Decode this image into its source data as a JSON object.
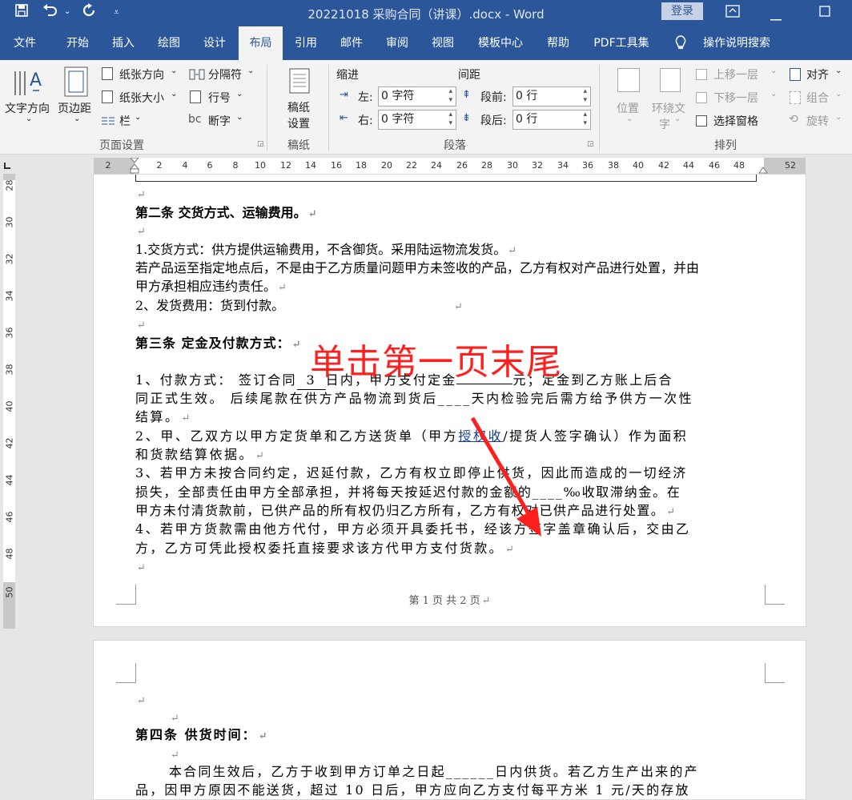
{
  "titlebar": {
    "title": "20221018 采购合同（讲课）.docx  -  Word",
    "login": "登录"
  },
  "tabs": [
    "文件",
    "开始",
    "插入",
    "绘图",
    "设计",
    "布局",
    "引用",
    "邮件",
    "审阅",
    "视图",
    "模板中心",
    "帮助",
    "PDF工具集",
    "操作说明搜索"
  ],
  "ribbon": {
    "text_direction": "文字方向",
    "margins": "页边距",
    "orientation": "纸张方向",
    "size": "纸张大小",
    "columns": "栏",
    "breaks": "分隔符",
    "line_numbers": "行号",
    "hyphenation": "断字",
    "page_setup": "页面设置",
    "manuscript_btn1": "稿纸",
    "manuscript_btn2": "设置",
    "manuscript": "稿纸",
    "indent": "缩进",
    "spacing": "间距",
    "left": "左:",
    "right": "右:",
    "before": "段前:",
    "after": "段后:",
    "left_val": "0 字符",
    "right_val": "0 字符",
    "before_val": "0 行",
    "after_val": "0 行",
    "paragraph": "段落",
    "position": "位置",
    "wrap1": "环绕文",
    "wrap2": "字",
    "bring_forward": "上移一层",
    "send_backward": "下移一层",
    "selection_pane": "选择窗格",
    "align": "对齐",
    "group": "组合",
    "rotate": "旋转",
    "arrange": "排列"
  },
  "ruler": {
    "h": [
      "2",
      "2",
      "4",
      "6",
      "8",
      "10",
      "12",
      "14",
      "16",
      "18",
      "20",
      "22",
      "24",
      "26",
      "28",
      "30",
      "32",
      "34",
      "36",
      "38",
      "40",
      "42",
      "44",
      "46",
      "48",
      "52"
    ],
    "v": [
      "28",
      "30",
      "32",
      "34",
      "36",
      "38",
      "40",
      "42",
      "44",
      "46",
      "48",
      "50"
    ]
  },
  "page1": {
    "l1": "第二条  交货方式、运输费用。",
    "l2": "1.交货方式：供方提供运输费用，不含御货。采用陆运物流发货。",
    "l3": "若产品运至指定地点后，不是由于乙方质量问题甲方未签收的产品，乙方有权对产品进行处置，并由",
    "l4": "甲方承担相应违约责任。",
    "l5": "2、发货费用：货到付款。",
    "l6": "第三条   定金及付款方式：",
    "l7a": "1、付款方式：   签订合同",
    "l7b": "3",
    "l7c": "日内，甲方支付定金",
    "l7d": "元；定金到乙方账上后合",
    "l8": "同正式生效。  后续尾款在供方产品物流到货后____天内检验完后需方给予供方一次性",
    "l9": "结算。",
    "l10a": "2、甲、乙双方以甲方定货单和乙方送货单（甲方",
    "l10b": "授权收",
    "l10c": "/提货人签字确认）作为面积",
    "l11": "和货款结算依据。",
    "l12": "3、若甲方未按合同约定，迟延付款，乙方有权立即停止供货，因此而造成的一切经济",
    "l13": "损失，全部责任由甲方全部承担，并将每天按延迟付款的金额的____‰收取滞纳金。在",
    "l14": "甲方未付清货款前，已供产品的所有权仍归乙方所有，乙方有权对已供产品进行处置。",
    "l15": "4、若甲方货款需由他方代付，甲方必须开具委托书，经该方签字盖章确认后，交由乙",
    "l16": "方，乙方可凭此授权委托直接要求该方代甲方支付货款。",
    "footer": "第 1 页 共 2 页"
  },
  "page2": {
    "l1": "第四条    供货时间：",
    "l2": "本合同生效后，乙方于收到甲方订单之日起______日内供货。若乙方生产出来的产",
    "l3": "品，因甲方原因不能送货，超过 10 日后，甲方应向乙方支付每平方米 1 元/天的存放"
  },
  "annotation": "单击第一页末尾",
  "para_mark": "↵"
}
